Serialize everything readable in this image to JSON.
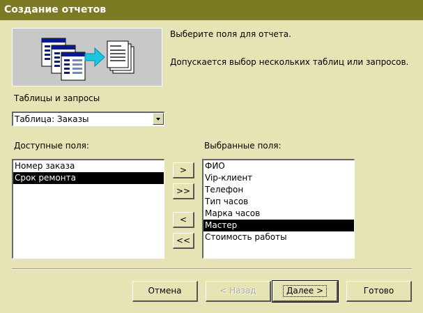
{
  "window": {
    "title": "Создание отчетов"
  },
  "intro": {
    "line1": "Выберите поля для отчета.",
    "line2": "Допускается выбор нескольких таблиц или запросов."
  },
  "tables": {
    "label": "Таблицы и запросы",
    "selected": "Таблица: Заказы"
  },
  "available": {
    "label": "Доступные поля:",
    "items": [
      "Номер заказа",
      "Срок ремонта"
    ],
    "selected_index": 1
  },
  "chosen": {
    "label": "Выбранные поля:",
    "items": [
      "ФИО",
      "Vip-клиент",
      "Телефон",
      "Тип часов",
      "Марка часов",
      "Мастер",
      "Стоимость работы"
    ],
    "selected_index": 5
  },
  "transfer": {
    "add": ">",
    "add_all": ">>",
    "remove": "<",
    "remove_all": "<<"
  },
  "buttons": {
    "cancel": "Отмена",
    "back": "< Назад",
    "next": "Далее >",
    "finish": "Готово"
  },
  "colors": {
    "dialog_bg": "#e6e4b4",
    "title_bg": "#7d7a24",
    "accent_arrow": "#19c8e0"
  }
}
